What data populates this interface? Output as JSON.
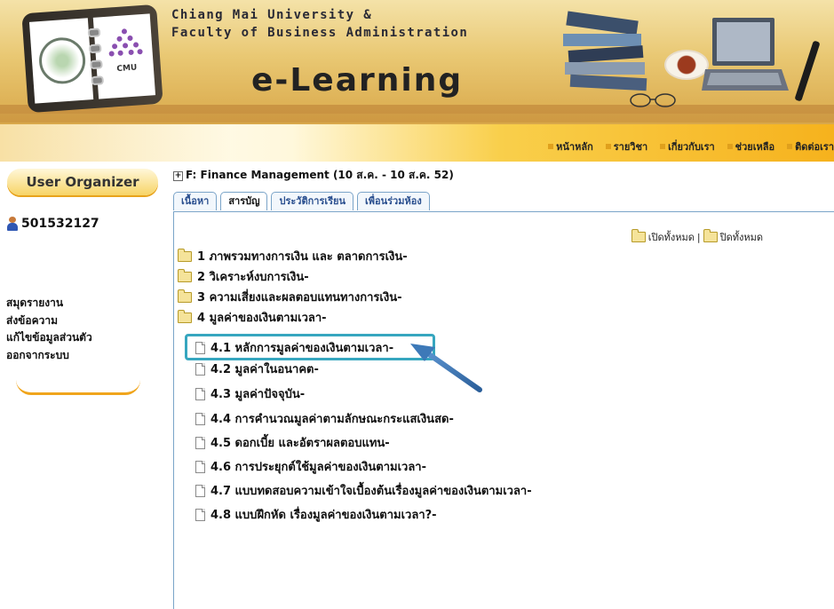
{
  "banner": {
    "line1": "Chiang Mai University &",
    "line2": "Faculty of Business Administration",
    "title": "e-Learning",
    "logo_text": "CMU"
  },
  "topnav": [
    "หน้าหลัก",
    "รายวิชา",
    "เกี่ยวกับเรา",
    "ช่วยเหลือ",
    "ติดต่อเรา"
  ],
  "sidebar": {
    "header": "User Organizer",
    "user_id": "501532127",
    "menu": [
      "สมุดรายงาน",
      "ส่งข้อความ",
      "แก้ไขข้อมูลส่วนตัว",
      "ออกจากระบบ"
    ]
  },
  "course": {
    "toggle": "+",
    "title": "F: Finance Management (10 ส.ค. - 10 ส.ค. 52)"
  },
  "tabs": [
    {
      "label": "เนื้อหา",
      "active": false
    },
    {
      "label": "สารบัญ",
      "active": true
    },
    {
      "label": "ประวัติการเรียน",
      "active": false
    },
    {
      "label": "เพื่อนร่วมห้อง",
      "active": false
    }
  ],
  "expand": {
    "open_all": "เปิดทั้งหมด",
    "separator": "|",
    "close_all": "ปิดทั้งหมด"
  },
  "tree": [
    {
      "label": "1 ภาพรวมทางการเงิน และ ตลาดการเงิน-",
      "type": "folder",
      "level": 0
    },
    {
      "label": "2 วิเคราะห์งบการเงิน-",
      "type": "folder",
      "level": 0
    },
    {
      "label": "3 ความเสี่ยงและผลตอบแทนทางการเงิน-",
      "type": "folder",
      "level": 0
    },
    {
      "label": "4 มูลค่าของเงินตามเวลา-",
      "type": "folder-open",
      "level": 0
    },
    {
      "label": "4.1 หลักการมูลค่าของเงินตามเวลา-",
      "type": "doc",
      "level": 1,
      "highlighted": true
    },
    {
      "label": "4.2 มูลค่าในอนาคต-",
      "type": "doc",
      "level": 1
    },
    {
      "label": "4.3 มูลค่าปัจจุบัน-",
      "type": "doc",
      "level": 1
    },
    {
      "label": "4.4 การคำนวณมูลค่าตามลักษณะกระแสเงินสด-",
      "type": "doc",
      "level": 1
    },
    {
      "label": "4.5 ดอกเบี้ย และอัตราผลตอบแทน-",
      "type": "doc",
      "level": 1
    },
    {
      "label": "4.6 การประยุกต์ใช้มูลค่าของเงินตามเวลา-",
      "type": "doc",
      "level": 1
    },
    {
      "label": "4.7 แบบทดสอบความเข้าใจเบื้องต้นเรื่องมูลค่าของเงินตามเวลา-",
      "type": "doc",
      "level": 1
    },
    {
      "label": "4.8 แบบฝึกหัด เรื่องมูลค่าของเงินตามเวลา?-",
      "type": "doc",
      "level": 1
    }
  ],
  "colors": {
    "accent": "#f6b21d",
    "tab_border": "#7aa4c8",
    "highlight": "#36a6bf",
    "arrow": "#3d79b8"
  }
}
